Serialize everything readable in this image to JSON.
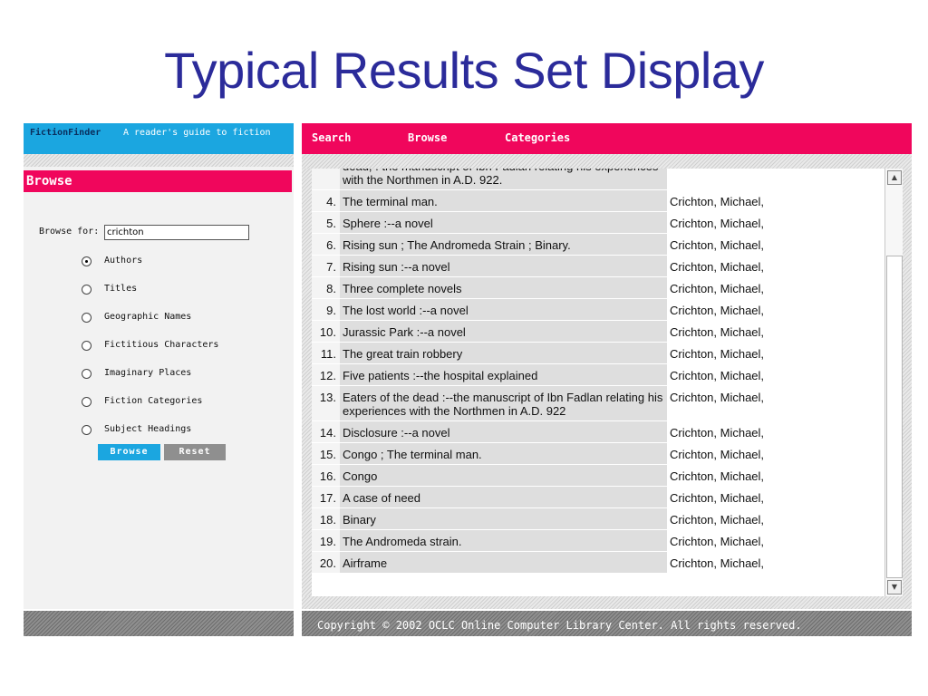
{
  "slide": {
    "title": "Typical Results Set Display"
  },
  "brand": {
    "name": "FictionFinder",
    "tagline": "A reader's guide to fiction"
  },
  "sidebar": {
    "heading": "Browse",
    "browse_for_label": "Browse for:",
    "browse_for_value": "crichton",
    "options": [
      {
        "label": "Authors",
        "checked": true
      },
      {
        "label": "Titles",
        "checked": false
      },
      {
        "label": "Geographic Names",
        "checked": false
      },
      {
        "label": "Fictitious Characters",
        "checked": false
      },
      {
        "label": "Imaginary Places",
        "checked": false
      },
      {
        "label": "Fiction Categories",
        "checked": false
      },
      {
        "label": "Subject Headings",
        "checked": false
      }
    ],
    "browse_button": "Browse",
    "reset_button": "Reset"
  },
  "nav": {
    "items": [
      "Search",
      "Browse",
      "Categories"
    ]
  },
  "results": {
    "rows": [
      {
        "num": "",
        "title": "dead, : the manuscript of Ibn Fadlan relating his experiences with the Northmen in A.D. 922.",
        "author": ""
      },
      {
        "num": "4.",
        "title": "The terminal man.",
        "author": "Crichton, Michael,"
      },
      {
        "num": "5.",
        "title": "Sphere :--a novel",
        "author": "Crichton, Michael,"
      },
      {
        "num": "6.",
        "title": "Rising sun ; The Andromeda Strain ; Binary.",
        "author": "Crichton, Michael,"
      },
      {
        "num": "7.",
        "title": "Rising sun :--a novel",
        "author": "Crichton, Michael,"
      },
      {
        "num": "8.",
        "title": "Three complete novels",
        "author": "Crichton, Michael,"
      },
      {
        "num": "9.",
        "title": "The lost world :--a novel",
        "author": "Crichton, Michael,"
      },
      {
        "num": "10.",
        "title": "Jurassic Park :--a novel",
        "author": "Crichton, Michael,"
      },
      {
        "num": "11.",
        "title": "The great train robbery",
        "author": "Crichton, Michael,"
      },
      {
        "num": "12.",
        "title": "Five patients :--the hospital explained",
        "author": "Crichton, Michael,"
      },
      {
        "num": "13.",
        "title": "Eaters of the dead :--the manuscript of Ibn Fadlan relating his experiences with the Northmen in A.D. 922",
        "author": "Crichton, Michael,"
      },
      {
        "num": "14.",
        "title": "Disclosure :--a novel",
        "author": "Crichton, Michael,"
      },
      {
        "num": "15.",
        "title": "Congo ; The terminal man.",
        "author": "Crichton, Michael,"
      },
      {
        "num": "16.",
        "title": "Congo",
        "author": "Crichton, Michael,"
      },
      {
        "num": "17.",
        "title": "A case of need",
        "author": "Crichton, Michael,"
      },
      {
        "num": "18.",
        "title": "Binary",
        "author": "Crichton, Michael,"
      },
      {
        "num": "19.",
        "title": "The Andromeda strain.",
        "author": "Crichton, Michael,"
      },
      {
        "num": "20.",
        "title": "Airframe",
        "author": "Crichton, Michael,"
      }
    ]
  },
  "footer": {
    "copyright": "Copyright © 2002 OCLC Online Computer Library Center. All rights reserved."
  },
  "icons": {
    "radio": "radio-button-icon",
    "scroll_up": "scroll-up-arrow-icon",
    "scroll_down": "scroll-down-arrow-icon"
  },
  "colors": {
    "title": "#2b2b9a",
    "accent_pink": "#f0065c",
    "accent_blue": "#1ba6e0",
    "gray_button": "#8f8f8f"
  }
}
